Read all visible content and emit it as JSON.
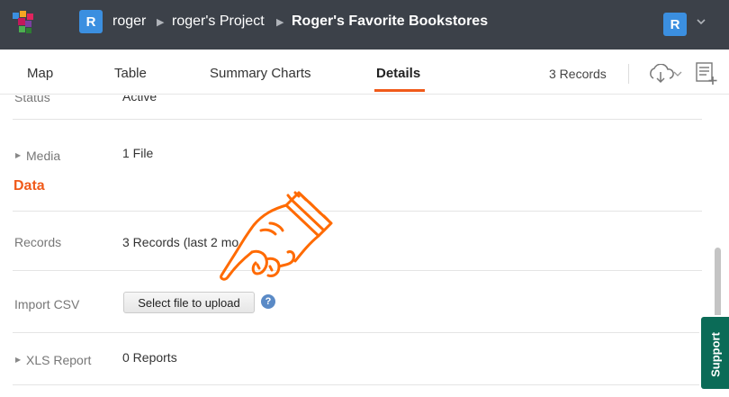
{
  "header": {
    "user_initial": "R",
    "user_name": "roger",
    "project_name": "roger's Project",
    "map_name": "Roger's Favorite Bookstores",
    "account_initial": "R"
  },
  "tabs": {
    "map": "Map",
    "table": "Table",
    "summary_charts": "Summary Charts",
    "details": "Details",
    "active": "Details"
  },
  "toolbar": {
    "records_count": "3 Records"
  },
  "details": {
    "status_label": "Status",
    "status_value": "Active",
    "media_label": "Media",
    "media_value": "1 File",
    "data_section_title": "Data",
    "records_label": "Records",
    "records_value": "3 Records (last 2 mo",
    "import_csv_label": "Import CSV",
    "upload_button_label": "Select file to upload",
    "help_icon_text": "?",
    "xls_report_label": "XLS Report",
    "xls_report_value": "0 Reports"
  },
  "support": {
    "label": "Support"
  },
  "colors": {
    "topbar": "#3c4149",
    "accent": "#f05a1a",
    "avatar": "#3b8fe0",
    "support": "#0b6b57",
    "help": "#5a8ac6"
  },
  "icons": [
    "app-logo-icon",
    "breadcrumb-arrow-icon",
    "chevron-down-icon",
    "cloud-download-icon",
    "add-to-list-icon",
    "disclosure-caret-icon",
    "help-icon",
    "pointing-hand-icon"
  ]
}
